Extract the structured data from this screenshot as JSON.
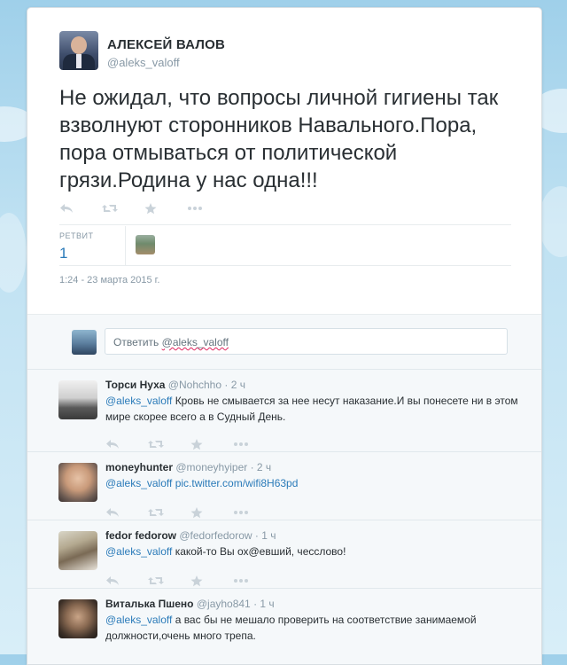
{
  "tweet": {
    "full_name": "АЛЕКСЕЙ ВАЛОВ",
    "handle": "@aleks_valoff",
    "text": "Не ожидал, что вопросы личной гигиены так взволнуют сторонников Навального.Пора, пора отмываться от политической грязи.Родина у нас одна!!!",
    "retweet_label": "РЕТВИТ",
    "retweet_count": "1",
    "timestamp": "1:24 - 23 марта 2015 г."
  },
  "reply_composer": {
    "prefix": "Ответить ",
    "mention": "@aleks_valoff"
  },
  "replies": [
    {
      "name": "Торси Нуха",
      "handle": "@Nohchho",
      "time": "· 2 ч",
      "mention": "@aleks_valoff",
      "text": "Кровь не смывается за нее несут наказание.И вы понесете ни в этом мире скорее всего а в Судный День."
    },
    {
      "name": "moneyhunter",
      "handle": "@moneyhyiper",
      "time": "· 2 ч",
      "mention": "@aleks_valoff",
      "text": "pic.twitter.com/wifi8H63pd"
    },
    {
      "name": "fedor fedorow",
      "handle": "@fedorfedorow",
      "time": "· 1 ч",
      "mention": "@aleks_valoff",
      "text": "какой-то Вы ох@евший, чесслово!"
    },
    {
      "name": "Виталька Пшено",
      "handle": "@jayho841",
      "time": "· 1 ч",
      "mention": "@aleks_valoff",
      "text": "а вас бы не мешало проверить на соответствие занимаемой должности,очень много трепа."
    }
  ],
  "icons": {
    "reply": "reply-icon",
    "retweet": "retweet-icon",
    "favorite": "star-icon",
    "more": "more-icon"
  },
  "colors": {
    "link": "#2b7bb9",
    "text": "#292f33",
    "muted": "#8899a6",
    "action": "#c9d2d9"
  }
}
